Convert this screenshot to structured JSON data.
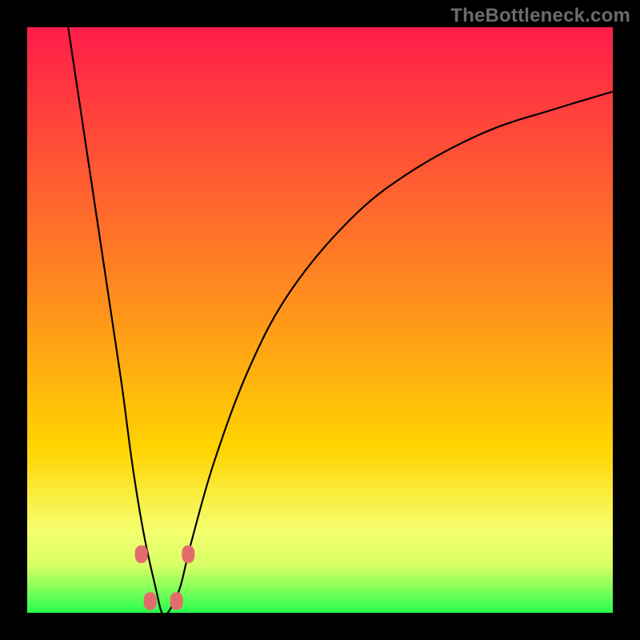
{
  "watermark": "TheBottleneck.com",
  "colors": {
    "frame": "#000000",
    "gradient_top": "#ff1d4a",
    "gradient_mid": "#ffd400",
    "gradient_low_band": "#f6ff6f",
    "gradient_bottom": "#27ff4d",
    "curve": "#000000",
    "marker": "#e46b6b",
    "watermark": "#6b6b6b"
  },
  "chart_data": {
    "type": "line",
    "title": "",
    "xlabel": "",
    "ylabel": "",
    "xlim": [
      0,
      100
    ],
    "ylim": [
      0,
      100
    ],
    "x_minimum": 23,
    "series": [
      {
        "name": "bottleneck-curve",
        "x": [
          7,
          10,
          13,
          16,
          18,
          20,
          22,
          23,
          24,
          26,
          28,
          32,
          38,
          45,
          55,
          65,
          78,
          90,
          100
        ],
        "values": [
          100,
          80,
          60,
          40,
          25,
          13,
          4,
          0,
          0,
          4,
          12,
          26,
          42,
          55,
          67,
          75,
          82,
          86,
          89
        ]
      }
    ],
    "markers": [
      {
        "x": 19.5,
        "y": 10
      },
      {
        "x": 27.5,
        "y": 10
      },
      {
        "x": 21.0,
        "y": 2
      },
      {
        "x": 25.5,
        "y": 2
      }
    ],
    "gradient_stops": [
      {
        "pos": 0.0,
        "color": "#ff1d4a"
      },
      {
        "pos": 0.45,
        "color": "#ff8a1f"
      },
      {
        "pos": 0.72,
        "color": "#ffd400"
      },
      {
        "pos": 0.86,
        "color": "#f6ff6f"
      },
      {
        "pos": 0.92,
        "color": "#d7ff66"
      },
      {
        "pos": 1.0,
        "color": "#27ff4d"
      }
    ]
  }
}
